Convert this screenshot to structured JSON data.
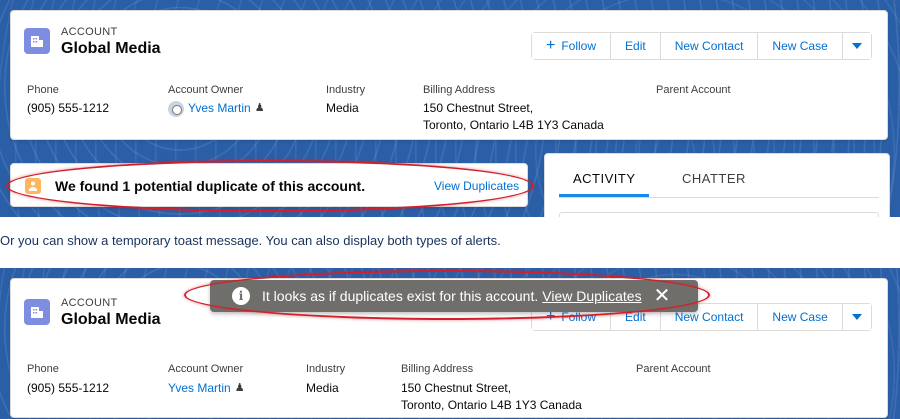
{
  "account": {
    "type": "ACCOUNT",
    "name": "Global Media"
  },
  "actions": {
    "follow": "Follow",
    "edit": "Edit",
    "new_contact": "New Contact",
    "new_case": "New Case"
  },
  "fields": {
    "phone_label": "Phone",
    "phone_value": "(905) 555-1212",
    "owner_label": "Account Owner",
    "owner_value": "Yves Martin",
    "industry_label": "Industry",
    "industry_value": "Media",
    "billing_label": "Billing Address",
    "billing_line1": "150 Chestnut Street,",
    "billing_line2": "Toronto, Ontario L4B 1Y3 Canada",
    "parent_label": "Parent Account"
  },
  "duplicate_alert": {
    "message": "We found 1 potential duplicate of this account.",
    "link": "View Duplicates"
  },
  "tabs": {
    "activity": "ACTIVITY",
    "chatter": "CHATTER"
  },
  "caption": "Or you can show a temporary toast message. You can also display both types of alerts.",
  "toast": {
    "message": "It looks as if duplicates exist for this account.",
    "link": "View Duplicates",
    "close": "✕"
  },
  "colors": {
    "brand": "#0070d2",
    "background_pattern": "#2a5fa8",
    "highlight": "#d0202a",
    "toast_bg": "#706e6b",
    "warning": "#ffb75d"
  },
  "icons": [
    "account-icon",
    "plus-icon",
    "chevron-down-icon",
    "change-owner-icon",
    "duplicate-warning-icon",
    "info-icon",
    "close-icon"
  ]
}
